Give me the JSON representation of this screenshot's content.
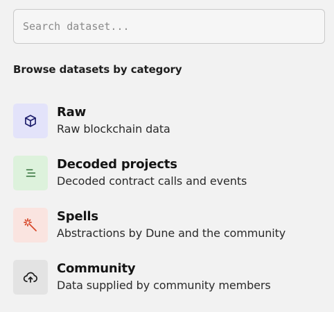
{
  "search": {
    "placeholder": "Search dataset...",
    "value": ""
  },
  "section_title": "Browse datasets by category",
  "categories": [
    {
      "name": "Raw",
      "description": "Raw blockchain data",
      "icon": "cube-icon",
      "bg_color": "#e3e3fa",
      "icon_color": "#1c1d6b"
    },
    {
      "name": "Decoded projects",
      "description": "Decoded contract calls and events",
      "icon": "lines-icon",
      "bg_color": "#ddf2dc",
      "icon_color": "#2f6e36"
    },
    {
      "name": "Spells",
      "description": "Abstractions by Dune and the community",
      "icon": "magic-wand-icon",
      "bg_color": "#fae4e0",
      "icon_color": "#d7492b"
    },
    {
      "name": "Community",
      "description": "Data supplied by community members",
      "icon": "cloud-upload-icon",
      "bg_color": "#e3e3e3",
      "icon_color": "#1b1b1b"
    }
  ]
}
